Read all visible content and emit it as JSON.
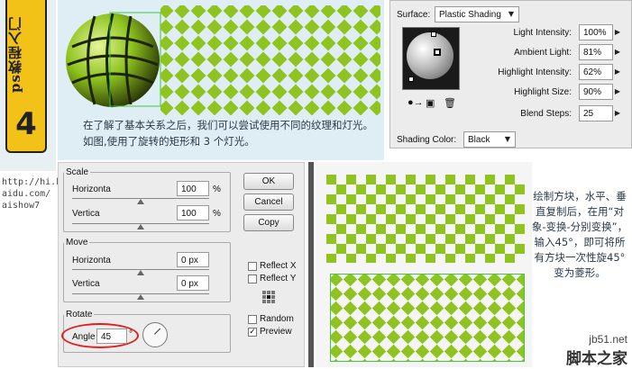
{
  "banner": {
    "series_text": "ps教程入门",
    "number": "4",
    "url_lines": [
      "http://hi.b",
      "aidu.com/",
      "aishow7"
    ]
  },
  "top": {
    "caption": "在了解了基本关系之后，我们可以尝试使用不同的纹理和灯光。如图,使用了旋转的矩形和 3 个灯光。"
  },
  "surface": {
    "surface_label": "Surface:",
    "surface_value": "Plastic Shading",
    "rows": [
      {
        "label": "Light Intensity:",
        "value": "100%"
      },
      {
        "label": "Ambient Light:",
        "value": "81%"
      },
      {
        "label": "Highlight Intensity:",
        "value": "62%"
      },
      {
        "label": "Highlight Size:",
        "value": "90%"
      },
      {
        "label": "Blend Steps:",
        "value": "25"
      }
    ],
    "shading_label": "Shading Color:",
    "shading_value": "Black"
  },
  "dialog": {
    "scale_legend": "Scale",
    "scale_h_label": "Horizonta",
    "scale_h_value": "100",
    "scale_v_label": "Vertica",
    "scale_v_value": "100",
    "percent": "%",
    "move_legend": "Move",
    "move_h_label": "Horizonta",
    "move_h_value": "0 px",
    "move_v_label": "Vertica",
    "move_v_value": "0 px",
    "rotate_legend": "Rotate",
    "angle_label": "Angle",
    "angle_value": "45",
    "degree": "°",
    "ok": "OK",
    "cancel": "Cancel",
    "copy": "Copy",
    "reflect_x": "Reflect X",
    "reflect_y": "Reflect Y",
    "random": "Random",
    "preview": "Preview"
  },
  "right": {
    "caption": "绘制方块，水平、垂直复制后，在用“对象-变换-分别变换”，输入45°，即可将所有方块一次性旋45°变为菱形。"
  },
  "watermark": {
    "site": "jb51.net",
    "name": "脚本之家"
  },
  "colors": {
    "green": "#8fc31f",
    "highlight_circle": "#e02020"
  }
}
